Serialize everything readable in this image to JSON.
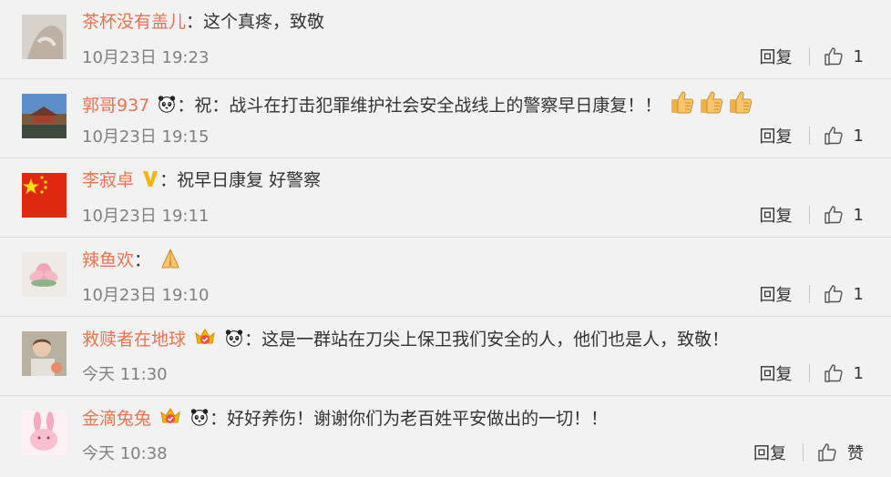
{
  "comments": [
    {
      "name": "茶杯没有盖儿",
      "separator": "：",
      "text": "这个真疼，致敬",
      "time": "10月23日 19:23",
      "reply_label": "回复",
      "like_count": "1"
    },
    {
      "name": "郭哥937",
      "separator": "：",
      "text": "祝：战斗在打击犯罪维护社会安全战线上的警察早日康复！！",
      "time": "10月23日 19:15",
      "reply_label": "回复",
      "like_count": "1",
      "icons": [
        "panda-badge-icon",
        "thumbs-up-emoji-icon",
        "thumbs-up-emoji-icon",
        "thumbs-up-emoji-icon"
      ]
    },
    {
      "name": "李寂卓",
      "separator": "：",
      "text": "祝早日康复 好警察",
      "time": "10月23日 19:11",
      "reply_label": "回复",
      "like_count": "1",
      "icons": [
        "verified-v-icon"
      ]
    },
    {
      "name": "辣鱼欢",
      "separator": "：",
      "text": "",
      "time": "10月23日 19:10",
      "reply_label": "回复",
      "like_count": "1",
      "icons": [
        "praying-hands-emoji-icon"
      ]
    },
    {
      "name": "救赎者在地球",
      "separator": "：",
      "text": "这是一群站在刀尖上保卫我们安全的人，他们也是人，致敬！",
      "time": "今天 11:30",
      "reply_label": "回复",
      "like_count": "1",
      "icons": [
        "crown-badge-icon",
        "panda-badge-icon"
      ]
    },
    {
      "name": "金滴兔兔",
      "separator": "：",
      "text": "好好养伤！谢谢你们为老百姓平安做出的一切！！",
      "time": "今天 10:38",
      "reply_label": "回复",
      "like_label": "赞",
      "icons": [
        "crown-badge-icon",
        "panda-badge-icon"
      ]
    }
  ],
  "colors": {
    "name": "#eb7350",
    "time": "#808080",
    "background": "#f2f2f2"
  }
}
